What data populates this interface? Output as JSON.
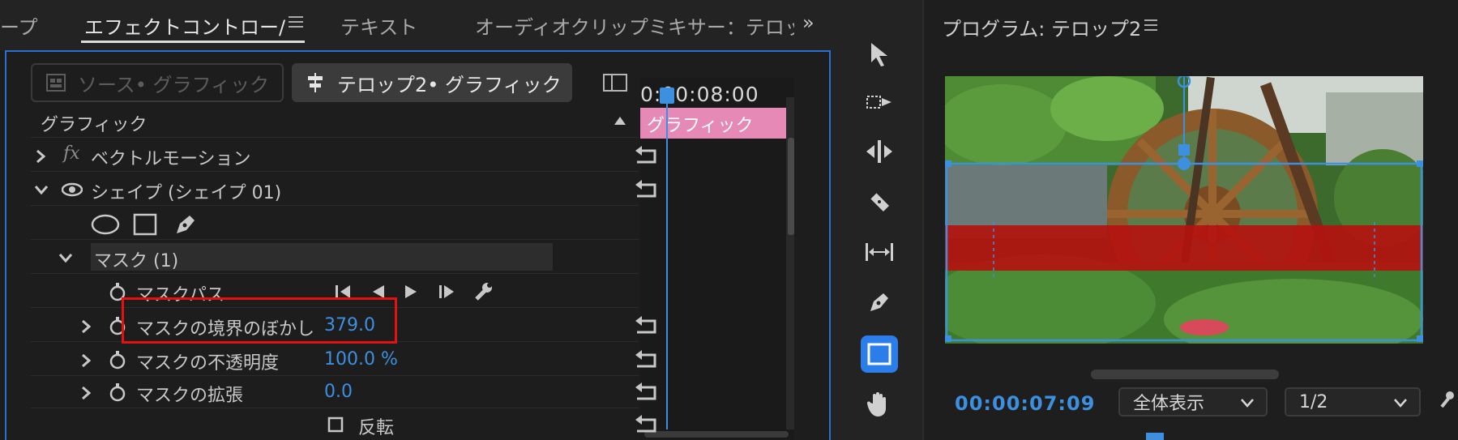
{
  "left_tabs": [
    {
      "label": "ープ",
      "active": false
    },
    {
      "label": "エフェクトコントロー/",
      "active": true
    },
    {
      "label": "テキスト",
      "active": false
    },
    {
      "label": "オーディオクリップミキサー：テロッ",
      "active": false
    }
  ],
  "tab_overflow": "»",
  "source_chip": "ソース• グラフィック",
  "target_chip": "テロップ2• グラフィック",
  "timeline": {
    "timecode": "0:00:08:00",
    "clip_label": "グラフィック"
  },
  "section_header": "グラフィック",
  "effects": {
    "vector_motion": {
      "fx": "fx",
      "label": "ベクトルモーション"
    },
    "shape": {
      "label": "シェイプ (シェイプ 01)"
    },
    "mask": {
      "label": "マスク (1)"
    },
    "mask_path": {
      "label": "マスクパス"
    },
    "mask_feather": {
      "label": "マスクの境界のぼかし",
      "value": "379.0"
    },
    "mask_opacity": {
      "label": "マスクの不透明度",
      "value": "100.0 %"
    },
    "mask_expansion": {
      "label": "マスクの拡張",
      "value": "0.0"
    },
    "invert": {
      "label": "反転"
    }
  },
  "program": {
    "title": "プログラム: テロップ2",
    "timecode": "00:00:07:09",
    "zoom": "全体表示",
    "resolution": "1/2"
  },
  "colors": {
    "accent_blue": "#3d8fe0",
    "panel_focus": "#2d6ed1",
    "clip_pink": "#e789b6",
    "highlight_red": "#e3110f",
    "telop_red": "#b3120f"
  },
  "icons": {
    "tools": [
      "selection-icon",
      "track-select-icon",
      "ripple-edit-icon",
      "razor-icon",
      "slip-icon",
      "pen-icon",
      "rectangle-icon",
      "hand-icon"
    ]
  }
}
